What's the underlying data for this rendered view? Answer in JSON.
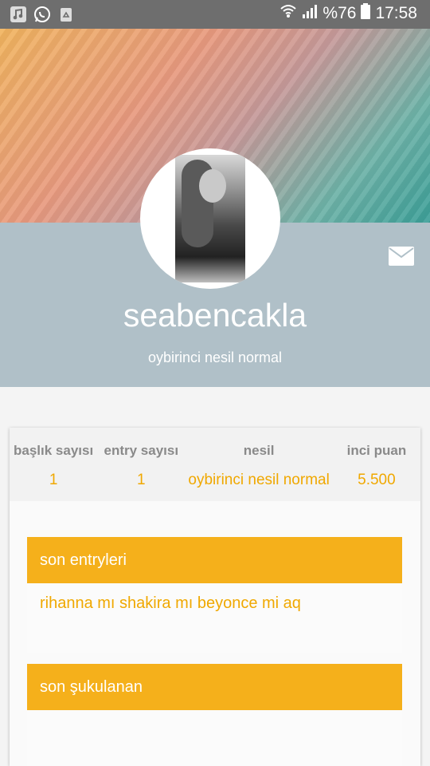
{
  "status_bar": {
    "battery": "%76",
    "time": "17:58",
    "icons": [
      "music-icon",
      "whatsapp-icon",
      "recycle-icon",
      "wifi-icon",
      "signal-icon",
      "battery-icon"
    ]
  },
  "profile": {
    "username": "seabencakla",
    "subtitle": "oybirinci nesil normal",
    "mail_icon": "envelope-icon"
  },
  "stats": [
    {
      "label": "başlık sayısı",
      "value": "1"
    },
    {
      "label": "entry sayısı",
      "value": "1"
    },
    {
      "label": "nesil",
      "value": "oybirinci nesil normal"
    },
    {
      "label": "inci puan",
      "value": "5.500"
    }
  ],
  "sections": {
    "recent_entries": {
      "title": "son entryleri",
      "items": [
        "rihanna mı shakira mı beyonce mi aq"
      ]
    },
    "recent_liked": {
      "title": "son şukulanan",
      "items": []
    }
  },
  "colors": {
    "accent": "#f5b01b",
    "accent_text": "#f0a800",
    "profile_band": "#b0c0c8",
    "status_bar": "#6e6e6e"
  }
}
